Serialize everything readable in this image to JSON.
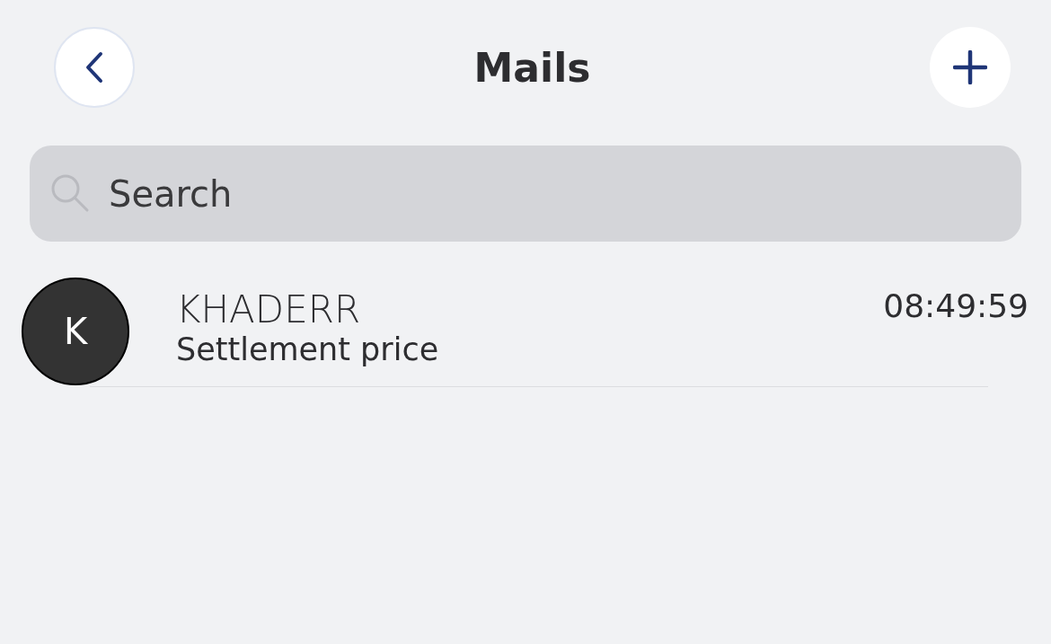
{
  "header": {
    "title": "Mails"
  },
  "search": {
    "placeholder": "Search"
  },
  "mails": [
    {
      "avatar_initial": "K",
      "sender": "KHADERR",
      "subject": "Settlement price",
      "time": "08:49:59"
    }
  ]
}
